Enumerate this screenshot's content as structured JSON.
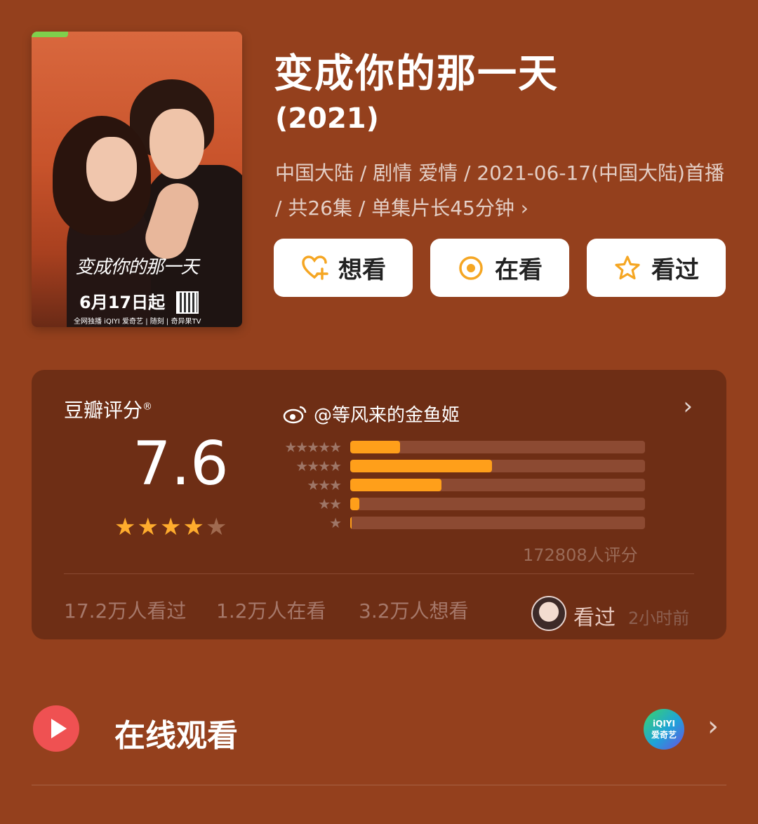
{
  "poster": {
    "title_art": "变成你的那一天",
    "date_text": "6月17日起",
    "platforms": "全网独播 iQIYI 爱奇艺 | 随刻 | 奇异果TV"
  },
  "header": {
    "title": "变成你的那一天",
    "year": "(2021)",
    "meta_line": "中国大陆 / 剧情 爱情 / 2021-06-17(中国大陆)首播 / 共26集 / 单集片长45分钟",
    "meta_chevron": "›"
  },
  "actions": [
    {
      "label": "想看",
      "icon": "heart-plus-icon"
    },
    {
      "label": "在看",
      "icon": "target-circle-icon"
    },
    {
      "label": "看过",
      "icon": "star-outline-icon"
    }
  ],
  "rating": {
    "label": "豆瓣评分",
    "label_mark": "®",
    "weibo_handle": "@等风来的金鱼姬",
    "score": "7.6",
    "stars_filled": 4,
    "stars_total": 5,
    "distribution": [
      {
        "stars": "★★★★★",
        "percent": 17
      },
      {
        "stars": "★★★★",
        "percent": 48
      },
      {
        "stars": "★★★",
        "percent": 31
      },
      {
        "stars": "★★",
        "percent": 3
      },
      {
        "stars": "★",
        "percent": 0.5
      }
    ],
    "count": "172808人评分",
    "stats": [
      "17.2万人看过",
      "1.2万人在看",
      "3.2万人想看"
    ],
    "friend_action": "看过",
    "friend_time": "2小时前",
    "arrow": "›",
    "accent_color": "#ff9f1a"
  },
  "online": {
    "label": "在线观看",
    "provider_line1": "iQIYI",
    "provider_line2": "爱奇艺",
    "arrow": "›"
  }
}
